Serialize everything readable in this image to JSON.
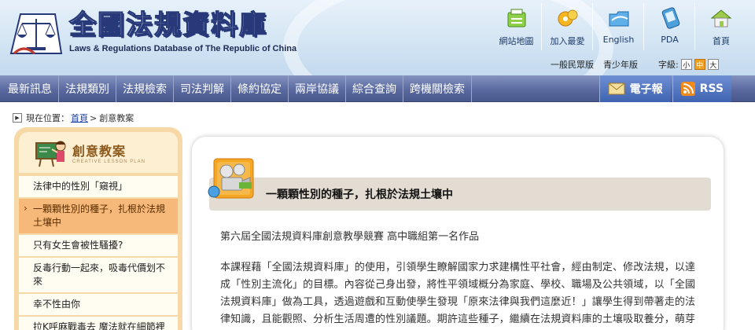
{
  "header": {
    "logo_title": "全國法規資料庫",
    "logo_subtitle": "Laws & Regulations Database of The Republic of China",
    "top_links": [
      {
        "label": "網站地圖",
        "icon": "sitemap-icon"
      },
      {
        "label": "加入最愛",
        "icon": "favorites-icon"
      },
      {
        "label": "English",
        "icon": "english-icon"
      },
      {
        "label": "PDA",
        "icon": "pda-icon"
      },
      {
        "label": "首頁",
        "icon": "home-icon"
      }
    ],
    "mode_links": [
      "一般民眾版",
      "青少年版"
    ],
    "font_size_label": "字級:",
    "font_sizes": [
      "小",
      "中",
      "大"
    ]
  },
  "nav": {
    "items": [
      "最新訊息",
      "法規類別",
      "法規檢索",
      "司法判解",
      "條約協定",
      "兩岸協議",
      "綜合查詢",
      "跨機關檢索"
    ],
    "epaper": "電子報",
    "rss": "RSS"
  },
  "breadcrumb": {
    "prefix": "現在位置：",
    "home": "首頁",
    "separator": ">",
    "current": "創意教案"
  },
  "sidebar": {
    "title": "創意教案",
    "subtitle": "CREATIVE LESSON PLAN",
    "items": [
      "法律中的性別「窺視」",
      "一顆顆性別的種子，扎根於法規土壤中",
      "只有女生會被性騷擾?",
      "反毒行動一起來，吸毒代價划不來",
      "幸不性由你",
      "拉K呼麻戰毒去 魔法就在細節裡"
    ]
  },
  "content": {
    "title": "一顆顆性別的種子，扎根於法規土壤中",
    "subtitle": "第六屆全國法規資料庫創意教學競賽 高中職組第一名作品",
    "body": "本課程藉「全國法規資料庫」的使用，引領學生瞭解國家力求建構性平社會，經由制定、修改法規，以達成「性別主流化」的目標。內容從己身出發，將性平領域概分為家庭、學校、職場及公共領域，以「全國法規資料庫」做為工具，透過遊戲和互動使學生發現「原來法律與我們這麼近！」讓學生得到帶著走的法律知識，且能觀照、分析生活周遭的性別議題。期許這些種子，繼續在法規資料庫的土壤吸取養分，萌芽成長並且傳播正確性平觀念。"
  }
}
